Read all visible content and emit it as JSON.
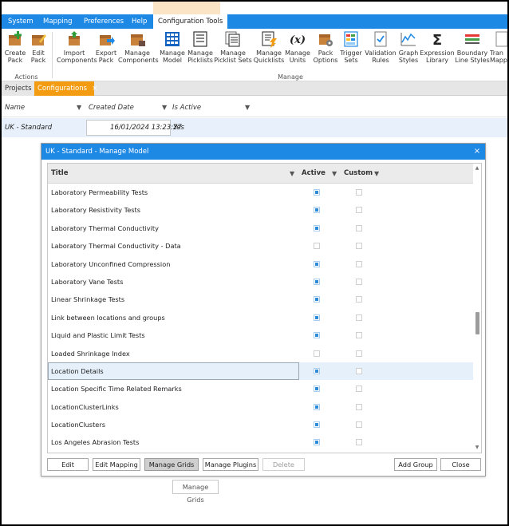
{
  "menu": {
    "items": [
      "System",
      "Mapping",
      "Preferences",
      "Help",
      "Configuration Tools"
    ],
    "active_index": 4
  },
  "ribbon": {
    "buttons": [
      {
        "line1": "Create",
        "line2": "Pack",
        "icon": "create-pack-icon"
      },
      {
        "line1": "Edit",
        "line2": "Pack",
        "icon": "edit-pack-icon"
      },
      {
        "line1": "Import",
        "line2": "Components",
        "icon": "import-components-icon"
      },
      {
        "line1": "Export",
        "line2": "Pack",
        "icon": "export-pack-icon"
      },
      {
        "line1": "Manage",
        "line2": "Components",
        "icon": "manage-components-icon"
      },
      {
        "line1": "Manage",
        "line2": "Model",
        "icon": "manage-model-icon"
      },
      {
        "line1": "Manage",
        "line2": "Picklists",
        "icon": "picklists-icon"
      },
      {
        "line1": "Manage",
        "line2": "Picklist Sets",
        "icon": "picklist-sets-icon"
      },
      {
        "line1": "Manage",
        "line2": "Quicklists",
        "icon": "quicklists-icon"
      },
      {
        "line1": "Manage",
        "line2": "Units",
        "icon": "units-icon"
      },
      {
        "line1": "Pack",
        "line2": "Options",
        "icon": "pack-options-icon"
      },
      {
        "line1": "Trigger",
        "line2": "Sets",
        "icon": "trigger-sets-icon"
      },
      {
        "line1": "Validation",
        "line2": "Rules",
        "icon": "validation-rules-icon"
      },
      {
        "line1": "Graph",
        "line2": "Styles",
        "icon": "graph-styles-icon"
      },
      {
        "line1": "Expression",
        "line2": "Library",
        "icon": "expression-library-icon"
      },
      {
        "line1": "Boundary",
        "line2": "Line Styles",
        "icon": "boundary-line-styles-icon"
      },
      {
        "line1": "Tran",
        "line2": "Mappi",
        "icon": "transfer-mapping-icon"
      }
    ],
    "groups": {
      "actions": "Actions",
      "manage": "Manage"
    }
  },
  "tabs": {
    "projects": "Projects",
    "configurations": "Configurations",
    "close_glyph": "×"
  },
  "grid": {
    "columns": [
      "Name",
      "Created Date",
      "Is Active"
    ],
    "row": {
      "name": "UK - Standard",
      "created": "16/01/2024 13:23:27",
      "active": "Yes"
    }
  },
  "dialog": {
    "title": "UK - Standard - Manage Model",
    "close_glyph": "×",
    "columns": {
      "title": "Title",
      "active": "Active",
      "custom": "Custom"
    },
    "rows": [
      {
        "title": "Laboratory Permeability Tests",
        "active": true,
        "custom": false
      },
      {
        "title": "Laboratory Resistivity Tests",
        "active": true,
        "custom": false
      },
      {
        "title": "Laboratory Thermal Conductivity",
        "active": true,
        "custom": false
      },
      {
        "title": "Laboratory Thermal Conductivity - Data",
        "active": false,
        "custom": false
      },
      {
        "title": "Laboratory Unconfined Compression",
        "active": true,
        "custom": false
      },
      {
        "title": "Laboratory Vane Tests",
        "active": true,
        "custom": false
      },
      {
        "title": "Linear Shrinkage Tests",
        "active": true,
        "custom": false
      },
      {
        "title": "Link between locations and groups",
        "active": true,
        "custom": false
      },
      {
        "title": "Liquid and Plastic Limit Tests",
        "active": true,
        "custom": false
      },
      {
        "title": "Loaded Shrinkage Index",
        "active": false,
        "custom": false
      },
      {
        "title": "Location Details",
        "active": true,
        "custom": false,
        "selected": true
      },
      {
        "title": "Location Specific Time Related Remarks",
        "active": true,
        "custom": false
      },
      {
        "title": "LocationClusterLinks",
        "active": true,
        "custom": false
      },
      {
        "title": "LocationClusters",
        "active": true,
        "custom": false
      },
      {
        "title": "Los Angeles Abrasion Tests",
        "active": true,
        "custom": false
      }
    ],
    "buttons": {
      "edit": "Edit",
      "edit_mapping": "Edit Mapping",
      "manage_grids": "Manage Grids",
      "manage_plugins": "Manage Plugins",
      "delete": "Delete",
      "add_group": "Add Group",
      "close": "Close"
    }
  },
  "floating_button": "Manage Grids",
  "colors": {
    "accent": "#1e88e5",
    "tab_active": "#f39c12",
    "checkbox": "#2e8bd8"
  }
}
